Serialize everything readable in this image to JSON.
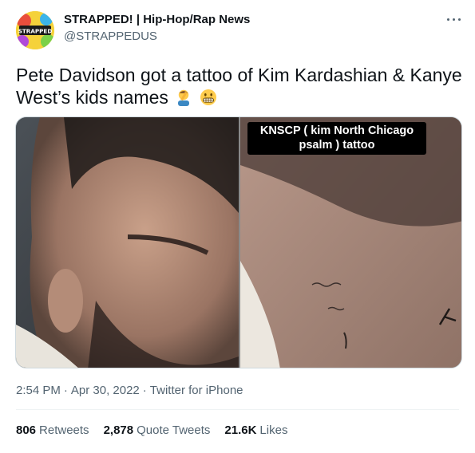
{
  "author": {
    "display_name": "STRAPPED! | Hip-Hop/Rap News",
    "handle": "@STRAPPEDUS",
    "avatar_text": "STRAPPED"
  },
  "tweet": {
    "text": "Pete Davidson got a tattoo of Kim Kardashian & Kanye West’s kids names",
    "emojis": [
      "man-facepalming-emoji",
      "grimacing-face-emoji"
    ]
  },
  "media": {
    "caption": "KNSCP ( kim North Chicago psalm ) tattoo",
    "photo_left": "face-closeup-photo",
    "photo_right": "neck-tattoo-closeup-photo"
  },
  "meta": {
    "time": "2:54 PM",
    "date": "Apr 30, 2022",
    "source": "Twitter for iPhone",
    "separator": "·"
  },
  "stats": {
    "retweets_count": "806",
    "retweets_label": "Retweets",
    "quotes_count": "2,878",
    "quotes_label": "Quote Tweets",
    "likes_count": "21.6K",
    "likes_label": "Likes"
  },
  "colors": {
    "text": "#0f1419",
    "secondary": "#536471",
    "border": "#eff3f4"
  }
}
